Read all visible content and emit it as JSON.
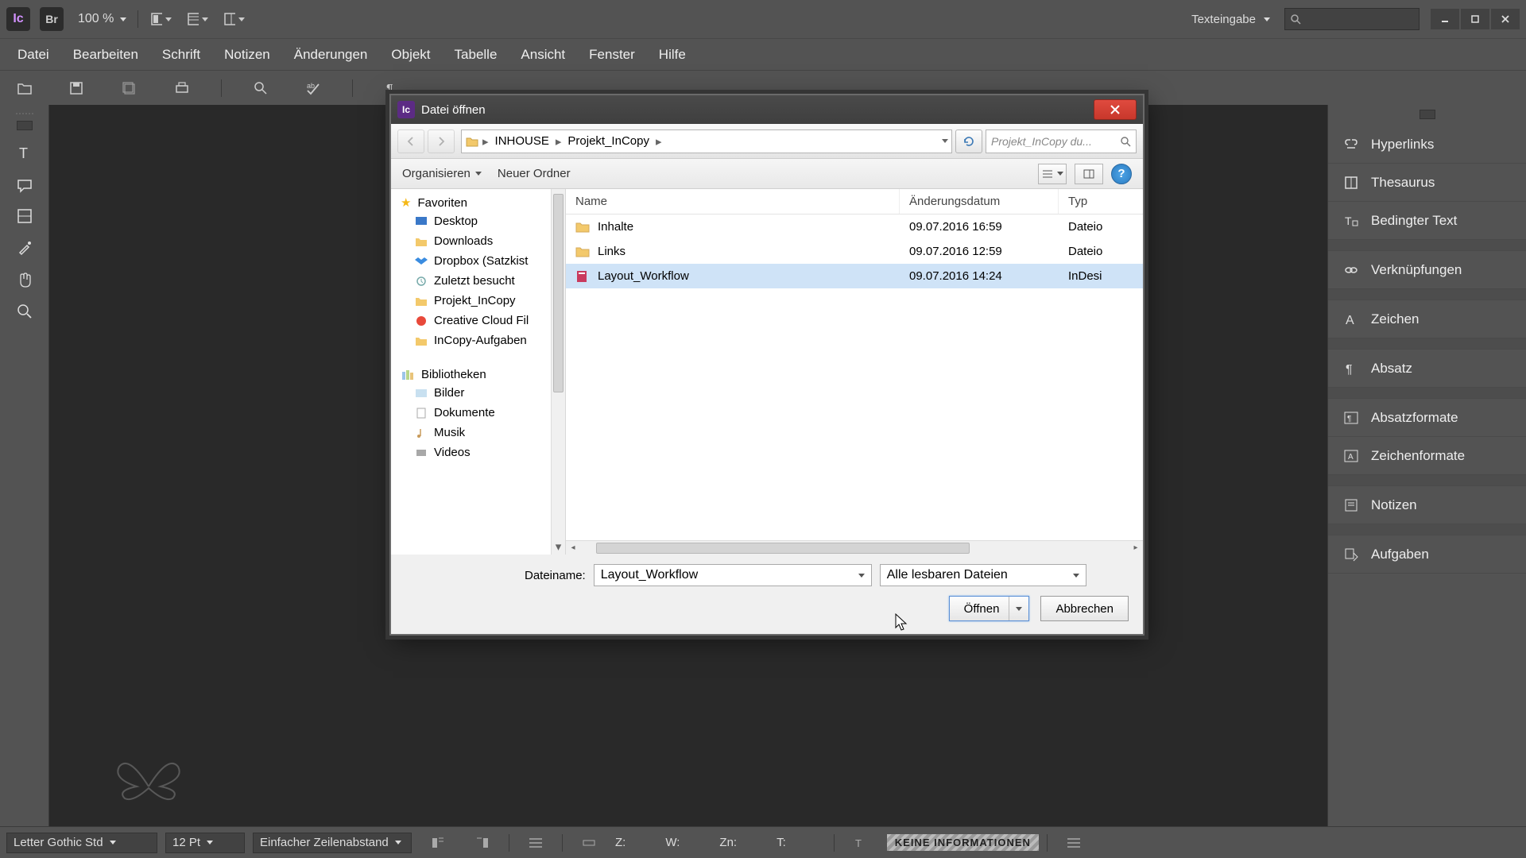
{
  "app": {
    "icon_text": "Ic",
    "br_text": "Br",
    "zoom": "100 %"
  },
  "workspace": "Texteingabe",
  "menu": [
    "Datei",
    "Bearbeiten",
    "Schrift",
    "Notizen",
    "Änderungen",
    "Objekt",
    "Tabelle",
    "Ansicht",
    "Fenster",
    "Hilfe"
  ],
  "panels": [
    {
      "label": "Hyperlinks",
      "icon": "link"
    },
    {
      "label": "Thesaurus",
      "icon": "book"
    },
    {
      "label": "Bedingter Text",
      "icon": "cond"
    },
    {
      "label": "Verknüpfungen",
      "icon": "chain"
    },
    {
      "label": "Zeichen",
      "icon": "A"
    },
    {
      "label": "Absatz",
      "icon": "para"
    },
    {
      "label": "Absatzformate",
      "icon": "paraf"
    },
    {
      "label": "Zeichenformate",
      "icon": "charf"
    },
    {
      "label": "Notizen",
      "icon": "note"
    },
    {
      "label": "Aufgaben",
      "icon": "task"
    }
  ],
  "status": {
    "font": "Letter Gothic Std",
    "size": "12 Pt",
    "spacing": "Einfacher Zeilenabstand",
    "fields": {
      "z": "Z:",
      "w": "W:",
      "zn": "Zn:",
      "t": "T:"
    },
    "info": "KEINE INFORMATIONEN"
  },
  "dialog": {
    "title": "Datei öffnen",
    "breadcrumb": [
      "INHOUSE",
      "Projekt_InCopy"
    ],
    "search_placeholder": "Projekt_InCopy du...",
    "toolbar": {
      "organize": "Organisieren",
      "new_folder": "Neuer Ordner"
    },
    "sidebar": {
      "favorites": "Favoriten",
      "favorites_items": [
        "Desktop",
        "Downloads",
        "Dropbox (Satzkist",
        "Zuletzt besucht",
        "Projekt_InCopy",
        "Creative Cloud Fil",
        "InCopy-Aufgaben"
      ],
      "libraries": "Bibliotheken",
      "libraries_items": [
        "Bilder",
        "Dokumente",
        "Musik",
        "Videos"
      ]
    },
    "columns": {
      "name": "Name",
      "date": "Änderungsdatum",
      "type": "Typ"
    },
    "rows": [
      {
        "name": "Inhalte",
        "date": "09.07.2016 16:59",
        "type": "Dateio",
        "kind": "folder",
        "selected": false
      },
      {
        "name": "Links",
        "date": "09.07.2016 12:59",
        "type": "Dateio",
        "kind": "folder",
        "selected": false
      },
      {
        "name": "Layout_Workflow",
        "date": "09.07.2016 14:24",
        "type": "InDesi",
        "kind": "indd",
        "selected": true
      }
    ],
    "footer": {
      "filename_label": "Dateiname:",
      "filename_value": "Layout_Workflow",
      "filter": "Alle lesbaren Dateien",
      "open": "Öffnen",
      "cancel": "Abbrechen"
    }
  }
}
